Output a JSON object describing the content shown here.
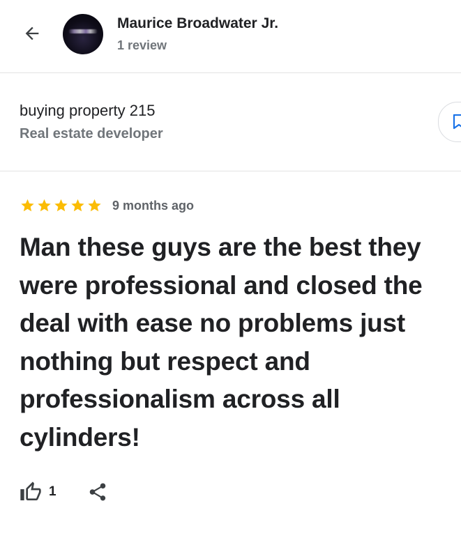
{
  "header": {
    "back_icon": "arrow-left-icon",
    "avatar_icon": "reviewer-avatar",
    "reviewer_name": "Maurice Broadwater Jr.",
    "review_count": "1 review"
  },
  "business": {
    "name": "buying property 215",
    "category": "Real estate developer",
    "save_icon": "bookmark-icon"
  },
  "review": {
    "rating": 5,
    "max_rating": 5,
    "star_color": "#fbbc04",
    "time": "9 months ago",
    "text": "Man these guys are the best they were professional and closed the deal with ease no problems just nothing but respect and professionalism across all cylinders!"
  },
  "actions": {
    "like_icon": "thumbs-up-icon",
    "like_count": "1",
    "share_icon": "share-icon"
  },
  "colors": {
    "primary_text": "#202124",
    "secondary_text": "#70757a",
    "divider": "#e3e3e3",
    "save_accent": "#1a73e8"
  }
}
